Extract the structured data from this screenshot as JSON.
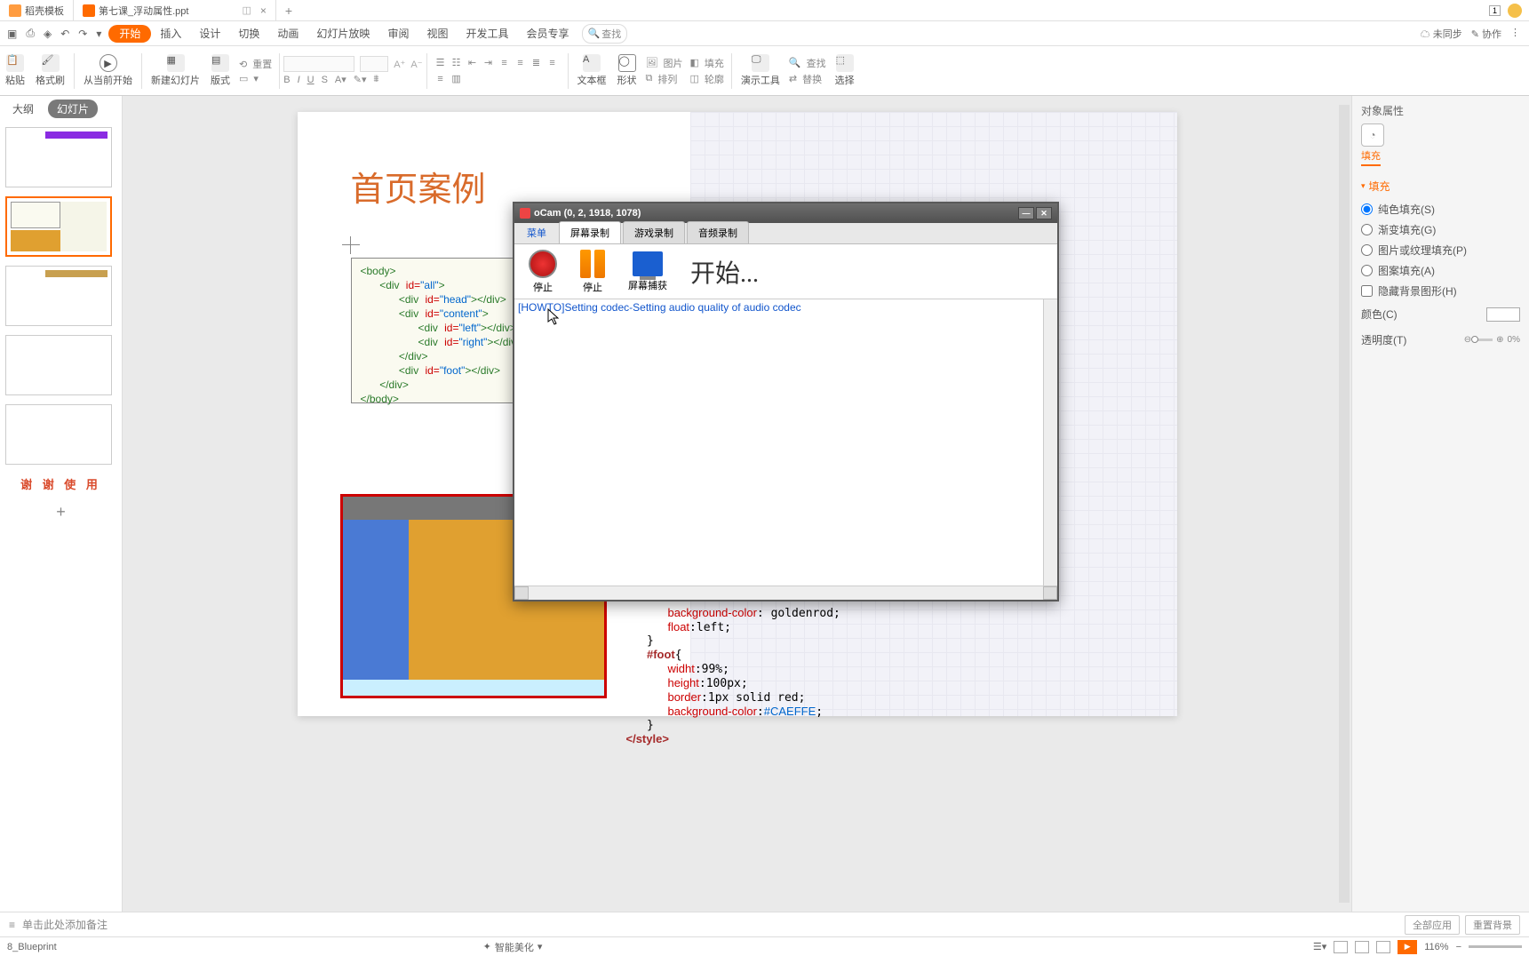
{
  "titlebar": {
    "tab1": "稻壳模板",
    "tab2": "第七课_浮动属性.ppt"
  },
  "menubar": {
    "items": [
      "开始",
      "插入",
      "设计",
      "切换",
      "动画",
      "幻灯片放映",
      "审阅",
      "视图",
      "开发工具",
      "会员专享"
    ],
    "search": "查找",
    "right": {
      "unsync": "未同步",
      "collab": "协作"
    }
  },
  "ribbon": {
    "paste": "粘贴",
    "fmt": "格式刷",
    "from": "从当前开始",
    "newslide": "新建幻灯片",
    "layout": "版式",
    "reset": "重置",
    "textbox": "文本框",
    "shape": "形状",
    "image": "图片",
    "arrange": "排列",
    "fill": "填充",
    "outline": "轮廓",
    "demo": "演示工具",
    "find": "查找",
    "replace": "替换",
    "select": "选择"
  },
  "sidepane": {
    "tabs": {
      "outline": "大纲",
      "slides": "幻灯片"
    },
    "thanks": "谢 谢 使 用"
  },
  "slide": {
    "title": "首页案例",
    "body_code": "<body>\n   <div id=\"all\">\n      <div id=\"head\"></div>\n      <div id=\"content\">\n         <div id=\"left\"></div>\n         <div id=\"right\"></div>\n      </div>\n      <div id=\"foot\"></div>\n   </div>\n</body>",
    "css_code": "      background-color: goldenrod;\n      float:left;\n   }\n   #foot{\n      widht:99%;\n      height:100px;\n      border:1px solid red;\n      background-color:#CAEFFE;\n   }\n</style>"
  },
  "proppane": {
    "header": "对象属性",
    "fill_tab": "填充",
    "section": "填充",
    "opts": {
      "solid": "纯色填充(S)",
      "grad": "渐变填充(G)",
      "pic": "图片或纹理填充(P)",
      "pattern": "图案填充(A)",
      "hidebg": "隐藏背景图形(H)"
    },
    "color": "颜色(C)",
    "opacity": "透明度(T)",
    "opacity_val": "0%"
  },
  "notes": {
    "placeholder": "单击此处添加备注",
    "applyall": "全部应用",
    "resetbg": "重置背景"
  },
  "status": {
    "left": "8_Blueprint",
    "beautify": "智能美化",
    "zoom": "116%"
  },
  "ocam": {
    "title": "oCam (0, 2, 1918, 1078)",
    "menu": "菜单",
    "tabs": {
      "screen": "屏幕录制",
      "game": "游戏录制",
      "audio": "音频录制"
    },
    "btns": {
      "stop1": "停止",
      "stop2": "停止",
      "capture": "屏幕捕获"
    },
    "start": "开始...",
    "log": "[HOWTO]Setting codec-Setting audio quality of audio codec"
  }
}
